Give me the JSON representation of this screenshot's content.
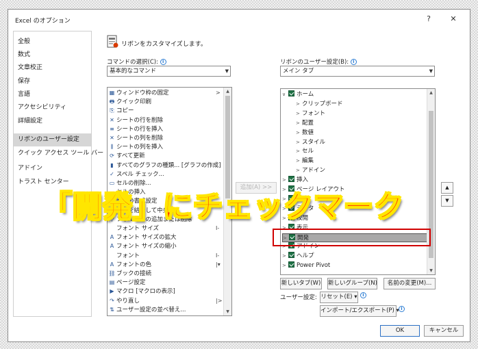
{
  "dialog": {
    "title": "Excel のオプション",
    "help": "?",
    "close": "✕"
  },
  "nav": [
    {
      "label": "全般"
    },
    {
      "label": "数式"
    },
    {
      "label": "文章校正"
    },
    {
      "label": "保存"
    },
    {
      "label": "言語"
    },
    {
      "label": "アクセシビリティ"
    },
    {
      "label": "詳細設定"
    },
    {
      "label": "リボンのユーザー設定",
      "selected": true
    },
    {
      "label": "クイック アクセス ツール バー"
    },
    {
      "label": "アドイン"
    },
    {
      "label": "トラスト センター"
    }
  ],
  "header": {
    "text": "リボンをカスタマイズします。"
  },
  "commands": {
    "label": "コマンドの選択(C):",
    "selected": "基本的なコマンド",
    "items": [
      {
        "icon": "▦",
        "label": "ウィンドウ枠の固定",
        "sub": ">"
      },
      {
        "icon": "🖶",
        "label": "クイック印刷"
      },
      {
        "icon": "⎘",
        "label": "コピー"
      },
      {
        "icon": "✕",
        "label": "シートの行を削除"
      },
      {
        "icon": "≡",
        "label": "シートの行を挿入"
      },
      {
        "icon": "✕",
        "label": "シートの列を削除"
      },
      {
        "icon": "⫼",
        "label": "シートの列を挿入"
      },
      {
        "icon": "⟳",
        "label": "すべて更新"
      },
      {
        "icon": "▮",
        "label": "すべてのグラフの種類... [グラフの作成]"
      },
      {
        "icon": "✓",
        "label": "スペル チェック..."
      },
      {
        "icon": "▭",
        "label": "セルの削除..."
      },
      {
        "icon": "",
        "label": "セルの挿入"
      },
      {
        "icon": "",
        "label": "セルの書式設定"
      },
      {
        "icon": "",
        "label": "セルを結合して中央揃え"
      },
      {
        "icon": "▽",
        "label": "フィルターの追加または削除"
      },
      {
        "icon": "",
        "label": "フォント サイズ",
        "sub": "I-"
      },
      {
        "icon": "A",
        "label": "フォント サイズの拡大"
      },
      {
        "icon": "A",
        "label": "フォント サイズの縮小"
      },
      {
        "icon": "",
        "label": "フォント",
        "sub": "I-"
      },
      {
        "icon": "A",
        "label": "フォントの色",
        "sub": "|▾"
      },
      {
        "icon": "⛓",
        "label": "ブックの接続"
      },
      {
        "icon": "▤",
        "label": "ページ設定"
      },
      {
        "icon": "▶",
        "label": "マクロ [マクロの表示]"
      },
      {
        "icon": "↷",
        "label": "やり直し",
        "sub": "|>"
      },
      {
        "icon": "⇅",
        "label": "ユーザー設定の並べ替え..."
      }
    ]
  },
  "add_button": "追加(A) >>",
  "ribbon": {
    "label": "リボンのユーザー設定(B):",
    "selected": "メイン タブ",
    "tree": [
      {
        "level": 0,
        "chev": "∨",
        "check": true,
        "label": "ホーム"
      },
      {
        "level": 1,
        "chev": ">",
        "check": false,
        "label": "クリップボード"
      },
      {
        "level": 1,
        "chev": ">",
        "check": false,
        "label": "フォント"
      },
      {
        "level": 1,
        "chev": ">",
        "check": false,
        "label": "配置"
      },
      {
        "level": 1,
        "chev": ">",
        "check": false,
        "label": "数値"
      },
      {
        "level": 1,
        "chev": ">",
        "check": false,
        "label": "スタイル"
      },
      {
        "level": 1,
        "chev": ">",
        "check": false,
        "label": "セル"
      },
      {
        "level": 1,
        "chev": ">",
        "check": false,
        "label": "編集"
      },
      {
        "level": 1,
        "chev": ">",
        "check": false,
        "label": "アドイン"
      },
      {
        "level": 0,
        "chev": ">",
        "check": true,
        "label": "挿入"
      },
      {
        "level": 0,
        "chev": ">",
        "check": true,
        "label": "ページ レイアウト"
      },
      {
        "level": 0,
        "chev": ">",
        "check": true,
        "label": "数式"
      },
      {
        "level": 0,
        "chev": ">",
        "check": true,
        "label": "データ"
      },
      {
        "level": 0,
        "chev": ">",
        "check": true,
        "label": "校閲"
      },
      {
        "level": 0,
        "chev": ">",
        "check": true,
        "label": "表示"
      },
      {
        "level": 0,
        "chev": ">",
        "check": true,
        "label": "開発",
        "selected": true
      },
      {
        "level": 0,
        "chev": ">",
        "check": true,
        "label": "アドイン"
      },
      {
        "level": 0,
        "chev": ">",
        "check": true,
        "label": "ヘルプ"
      },
      {
        "level": 0,
        "chev": ">",
        "check": true,
        "label": "Power Pivot"
      }
    ]
  },
  "buttons": {
    "new_tab": "新しいタブ(W)",
    "new_group": "新しいグループ(N)",
    "rename": "名前の変更(M)...",
    "user_settings_label": "ユーザー設定:",
    "reset": "リセット(E) ▾",
    "import_export": "インポート/エクスポート(P) ▾",
    "ok": "OK",
    "cancel": "キャンセル",
    "move_up": "▲",
    "move_down": "▼"
  },
  "overlay": {
    "text": "「開発」にチェックマーク"
  },
  "colors": {
    "overlay_fill": "#ff2d00",
    "overlay_stroke": "#ffe600",
    "highlight": "#d00000",
    "checkbox": "#1e7145"
  }
}
